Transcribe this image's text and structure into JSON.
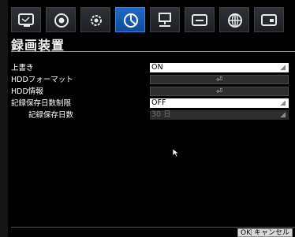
{
  "toolbar": {
    "tabs": [
      {
        "icon": "monitor-icon",
        "active": false
      },
      {
        "icon": "record-icon",
        "active": false
      },
      {
        "icon": "settings-gear-icon",
        "active": false
      },
      {
        "icon": "pie-chart-icon",
        "active": true
      },
      {
        "icon": "network-computer-icon",
        "active": false
      },
      {
        "icon": "keyboard-icon",
        "active": false
      },
      {
        "icon": "globe-icon",
        "active": false
      },
      {
        "icon": "display-icon",
        "active": false
      }
    ]
  },
  "page": {
    "title": "録画装置"
  },
  "settings": {
    "overwrite": {
      "label": "上書き",
      "value": "ON"
    },
    "hdd_format": {
      "label": "HDDフォーマット",
      "button": "⏎"
    },
    "hdd_info": {
      "label": "HDD情報",
      "button": "⏎"
    },
    "retention_limit": {
      "label": "記録保存日数制限",
      "value": "OFF"
    },
    "retention_days": {
      "label": "記録保存日数",
      "value": "30 日"
    }
  },
  "footer": {
    "ok": "OK",
    "cancel": "キャンセル"
  },
  "colors": {
    "accent": "#1a5fb4",
    "background": "#000000",
    "field": "#ffffff",
    "divider": "#9d9d9d"
  }
}
